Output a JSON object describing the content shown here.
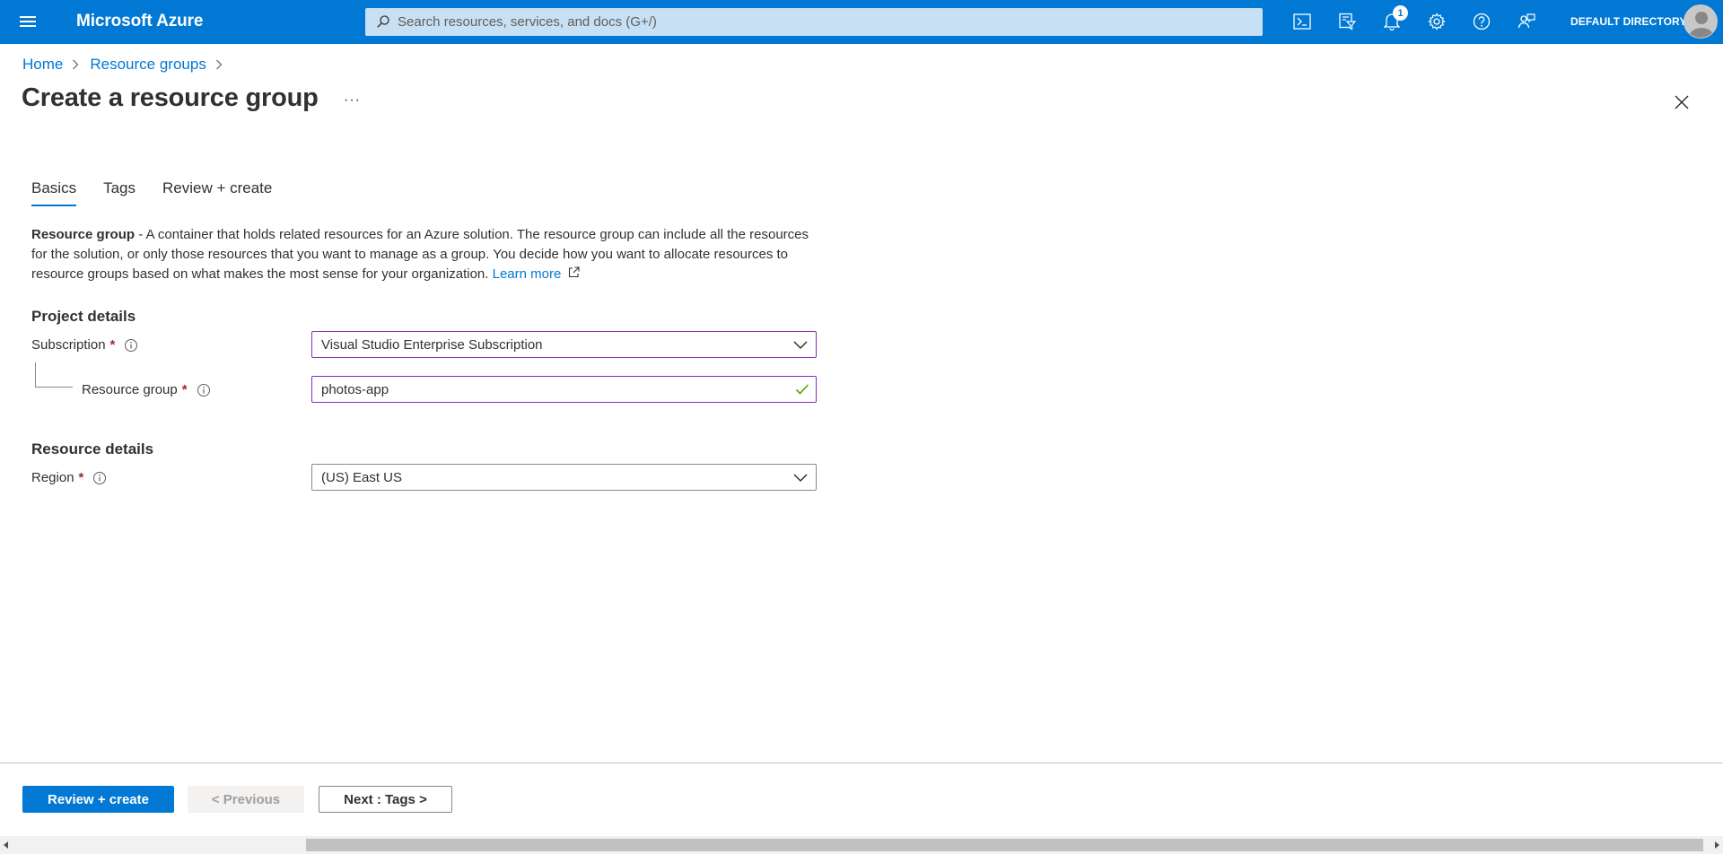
{
  "topbar": {
    "brand": "Microsoft Azure",
    "search_placeholder": "Search resources, services, and docs (G+/)",
    "notification_count": "1",
    "account_label": "DEFAULT DIRECTORY",
    "icons": [
      "menu-icon",
      "cloud-shell-icon",
      "directory-filter-icon",
      "notifications-icon",
      "settings-icon",
      "help-icon",
      "feedback-icon"
    ],
    "brand_color": "#0078d4"
  },
  "breadcrumb": {
    "items": [
      "Home",
      "Resource groups"
    ]
  },
  "page": {
    "title": "Create a resource group",
    "more_label": "···"
  },
  "tabs": [
    {
      "label": "Basics",
      "active": true
    },
    {
      "label": "Tags",
      "active": false
    },
    {
      "label": "Review + create",
      "active": false
    }
  ],
  "description": {
    "term": "Resource group",
    "text": " - A container that holds related resources for an Azure solution. The resource group can include all the resources for the solution, or only those resources that you want to manage as a group. You decide how you want to allocate resources to resource groups based on what makes the most sense for your organization. ",
    "link": "Learn more"
  },
  "project_details": {
    "title": "Project details",
    "subscription": {
      "label": "Subscription",
      "value": "Visual Studio Enterprise Subscription"
    },
    "resource_group": {
      "label": "Resource group",
      "value": "photos-app"
    }
  },
  "resource_details": {
    "title": "Resource details",
    "region": {
      "label": "Region",
      "value": "(US) East US"
    }
  },
  "footer": {
    "review_create": "Review + create",
    "previous": "< Previous",
    "next": "Next : Tags >"
  }
}
